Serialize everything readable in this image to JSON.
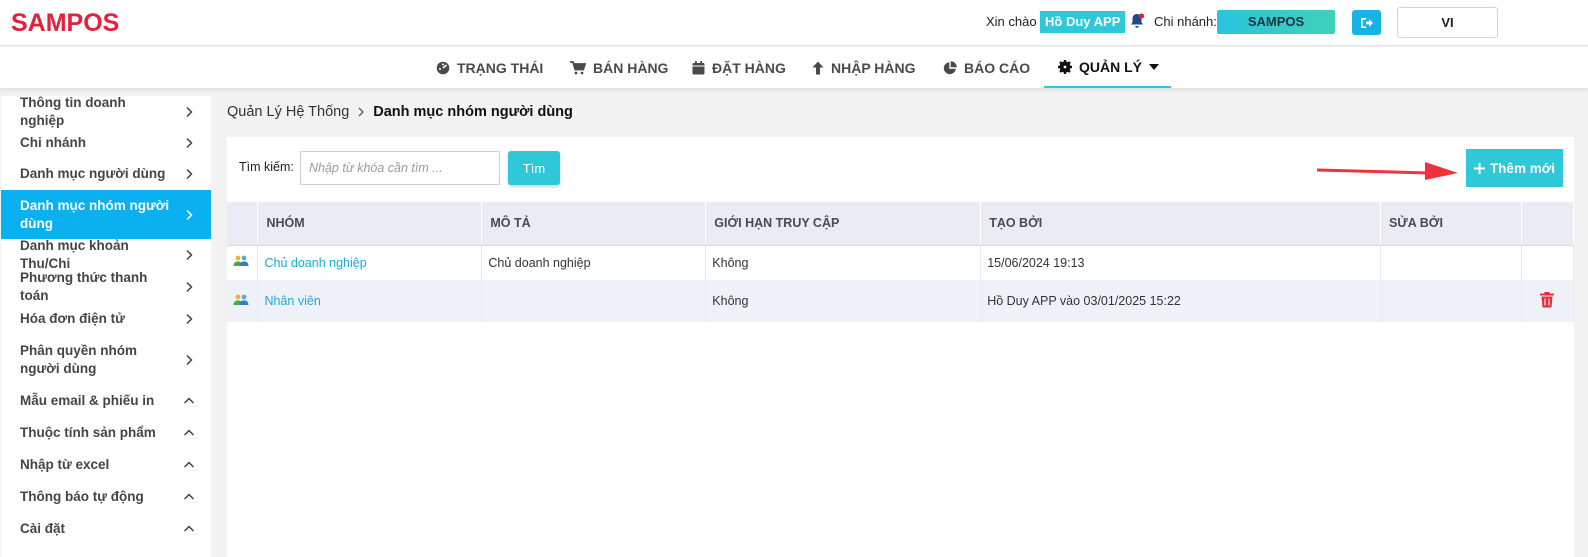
{
  "header": {
    "logo": "SAMPOS",
    "greeting": "Xin chào",
    "user_name": "Hồ Duy APP",
    "branch_label": "Chi nhánh:",
    "branch_name": "SAMPOS",
    "language": "VI",
    "icons": {
      "notification": "bell-icon",
      "logout": "logout-icon"
    }
  },
  "nav": {
    "items": [
      {
        "label": "TRẠNG THÁI",
        "icon": "dashboard-icon"
      },
      {
        "label": "BÁN HÀNG",
        "icon": "cart-icon"
      },
      {
        "label": "ĐẶT HÀNG",
        "icon": "calendar-icon"
      },
      {
        "label": "NHẬP HÀNG",
        "icon": "arrow-up-icon"
      },
      {
        "label": "BÁO CÁO",
        "icon": "pie-chart-icon"
      },
      {
        "label": "QUẢN LÝ",
        "icon": "gear-icon",
        "active": true
      }
    ]
  },
  "sidebar": {
    "items": [
      {
        "label": "Thông tin doanh nghiệp",
        "chevron": "right"
      },
      {
        "label": "Chi nhánh",
        "chevron": "right"
      },
      {
        "label": "Danh mục người dùng",
        "chevron": "right"
      },
      {
        "label": "Danh mục nhóm người dùng",
        "chevron": "right",
        "active": true
      },
      {
        "label": "Danh mục khoản Thu/Chi",
        "chevron": "right"
      },
      {
        "label": "Phương thức thanh toán",
        "chevron": "right"
      },
      {
        "label": "Hóa đơn điện tử",
        "chevron": "right"
      },
      {
        "label": "Phân quyền nhóm người dùng",
        "chevron": "right"
      },
      {
        "label": "Mẫu email & phiếu in",
        "chevron": "up"
      },
      {
        "label": "Thuộc tính sản phẩm",
        "chevron": "up"
      },
      {
        "label": "Nhập từ excel",
        "chevron": "up"
      },
      {
        "label": "Thông báo tự động",
        "chevron": "up"
      },
      {
        "label": "Cài đặt",
        "chevron": "up"
      }
    ]
  },
  "breadcrumb": {
    "parent": "Quản Lý Hệ Thống",
    "current": "Danh mục nhóm người dùng"
  },
  "search": {
    "label": "Tìm kiếm:",
    "placeholder": "Nhập từ khóa cần tìm ...",
    "button": "Tìm"
  },
  "add_button": "Thêm mới",
  "table": {
    "headers": [
      "NHÓM",
      "MÔ TẢ",
      "GIỚI HẠN TRUY CẬP",
      "TẠO BỞI",
      "SỬA BỞI"
    ],
    "rows": [
      {
        "group": "Chủ doanh nghiệp",
        "description": "Chủ doanh nghiệp",
        "access_limit": "Không",
        "created_by": "15/06/2024 19:13",
        "modified_by": "",
        "deletable": false
      },
      {
        "group": "Nhân viên",
        "description": "",
        "access_limit": "Không",
        "created_by": "Hồ Duy APP vào 03/01/2025 15:22",
        "modified_by": "",
        "deletable": true
      }
    ]
  },
  "colors": {
    "accent": "#2ec8d8",
    "active_sidebar": "#0ab0f0",
    "brand": "#e5203a",
    "delete": "#e03040",
    "arrow": "#f0323c"
  }
}
